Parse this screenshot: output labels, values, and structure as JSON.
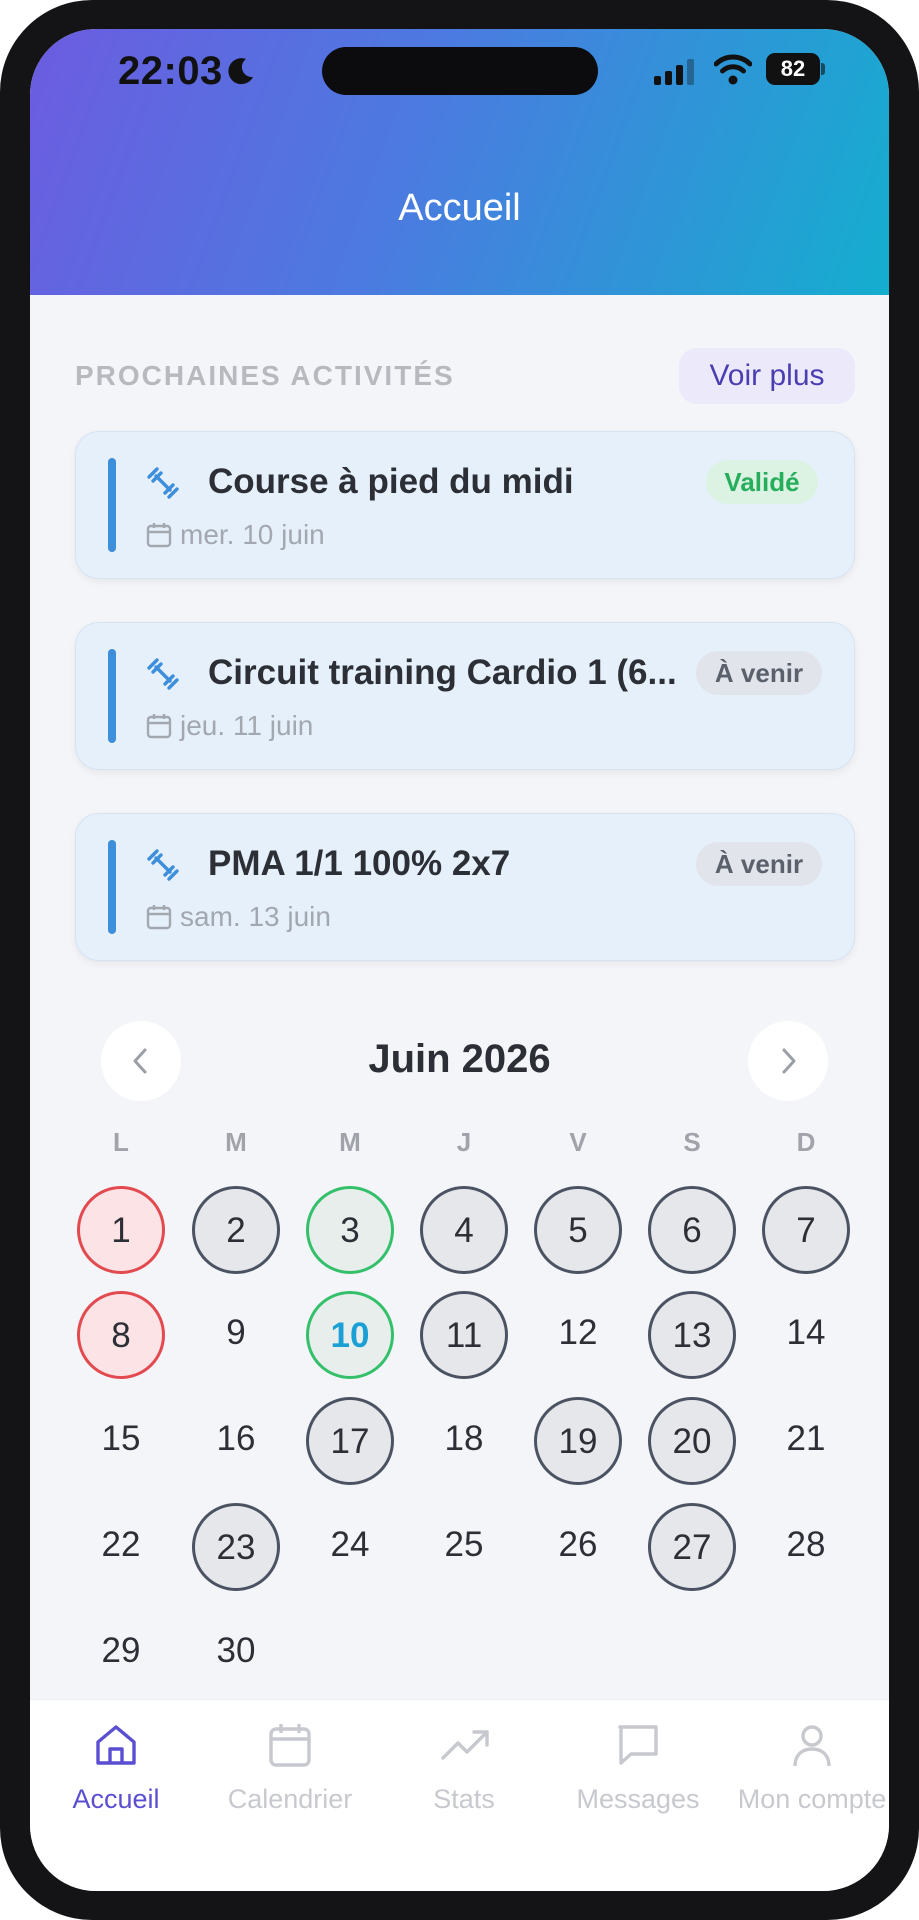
{
  "status_bar": {
    "time": "22:03",
    "battery": "82"
  },
  "header": {
    "title": "Accueil"
  },
  "activities": {
    "section_title": "PROCHAINES ACTIVITÉS",
    "see_more": "Voir plus",
    "items": [
      {
        "title": "Course à pied du midi",
        "date": "mer. 10 juin",
        "status": "Validé"
      },
      {
        "title": "Circuit training Cardio 1 (6...",
        "date": "jeu. 11 juin",
        "status": "À venir"
      },
      {
        "title": "PMA 1/1 100% 2x7",
        "date": "sam. 13 juin",
        "status": "À venir"
      }
    ]
  },
  "calendar": {
    "month": "Juin 2026",
    "weekdays": [
      "L",
      "M",
      "M",
      "J",
      "V",
      "S",
      "D"
    ],
    "days": [
      "1",
      "2",
      "3",
      "4",
      "5",
      "6",
      "7",
      "8",
      "9",
      "10",
      "11",
      "12",
      "13",
      "14",
      "15",
      "16",
      "17",
      "18",
      "19",
      "20",
      "21",
      "22",
      "23",
      "24",
      "25",
      "26",
      "27",
      "28",
      "29",
      "30"
    ],
    "day_markers": {
      "missed": [
        "1",
        "8"
      ],
      "completed": [
        "3",
        "10"
      ],
      "planned": [
        "2",
        "4",
        "5",
        "6",
        "7",
        "11",
        "13",
        "17",
        "19",
        "20",
        "23",
        "27"
      ],
      "today": "10"
    }
  },
  "tabbar": {
    "items": [
      {
        "label": "Accueil",
        "icon": "home-icon",
        "active": true
      },
      {
        "label": "Calendrier",
        "icon": "calendar-icon",
        "active": false
      },
      {
        "label": "Stats",
        "icon": "trending-up-icon",
        "active": false
      },
      {
        "label": "Messages",
        "icon": "message-icon",
        "active": false
      },
      {
        "label": "Mon compte",
        "icon": "user-icon",
        "active": false
      }
    ]
  },
  "colors": {
    "accent": "#5b4fd1",
    "header_gradient_start": "#6c5ce0",
    "header_gradient_end": "#14aecf",
    "activity_bar": "#3d8edb",
    "status_done": "#27ae5c",
    "missed": "#e24a4f",
    "completed": "#34c06a",
    "today": "#1aa0d4"
  }
}
